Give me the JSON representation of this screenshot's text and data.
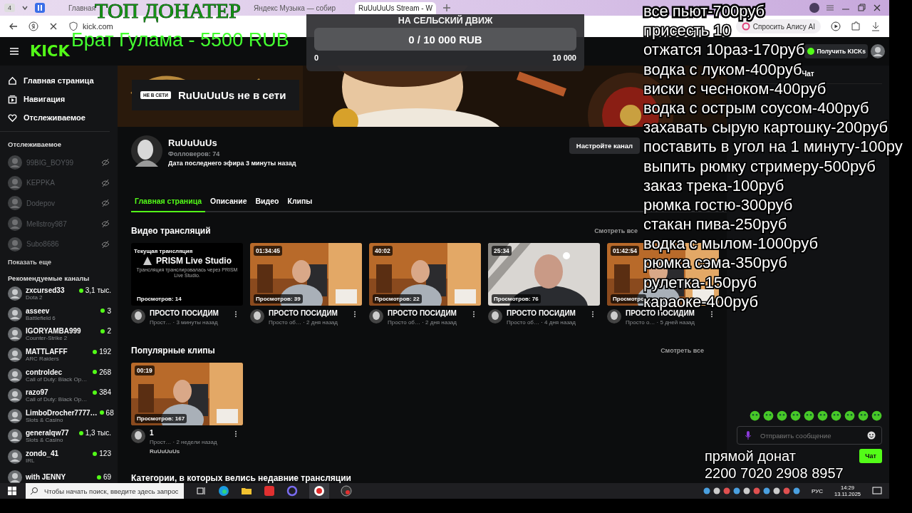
{
  "browser": {
    "tab_count": "4",
    "tabs": [
      {
        "title": "Главная",
        "selected": false
      },
      {
        "title": "Яндекс Музыка — собир",
        "selected": false
      },
      {
        "title": "RuUuUuUs Stream - W",
        "selected": true
      }
    ],
    "address": "kick.com",
    "alice_button": "Спросить Алису AI"
  },
  "kick": {
    "logo": "KICK",
    "kicks_button": "Получить KICKs",
    "nav": [
      {
        "label": "Главная страница"
      },
      {
        "label": "Навигация"
      },
      {
        "label": "Отслеживаемое"
      }
    ],
    "following_title": "Отслеживаемое",
    "following": [
      {
        "name": "99BIG_BOY99",
        "online": false
      },
      {
        "name": "KEPPKA",
        "online": false
      },
      {
        "name": "Dodepov",
        "online": false
      },
      {
        "name": "Mellstroy987",
        "online": false
      },
      {
        "name": "Subo8686",
        "online": false
      }
    ],
    "show_more": "Показать еще",
    "recommended_title": "Рекомендуемые каналы",
    "recommended": [
      {
        "name": "zxcursed33",
        "game": "Dota 2",
        "viewers": "3,1 тыс."
      },
      {
        "name": "asseev",
        "game": "Battlefield 6",
        "viewers": "3"
      },
      {
        "name": "IGORYAMBA999",
        "game": "Counter-Strike 2",
        "viewers": "2"
      },
      {
        "name": "MATTLAFFF",
        "game": "ARC Raiders",
        "viewers": "192"
      },
      {
        "name": "controldec",
        "game": "Call of Duty: Black Op…",
        "viewers": "268"
      },
      {
        "name": "razo97",
        "game": "Call of Duty: Black Op…",
        "viewers": "384"
      },
      {
        "name": "LimboDrocher7777…",
        "game": "Slots & Casino",
        "viewers": "68"
      },
      {
        "name": "generalqw77",
        "game": "Slots & Casino",
        "viewers": "1,3 тыс."
      },
      {
        "name": "zondo_41",
        "game": "IRL",
        "viewers": "123"
      },
      {
        "name": "with JENNY",
        "viewers": "69"
      }
    ],
    "offline_badge": "НЕ В СЕТИ",
    "offline_text": "RuUuUuUs не в сети",
    "channel": {
      "name": "RuUuUuUs",
      "followers": "Фолловеров: 74",
      "last_stream": "Дата последнего эфира 3 минуты назад",
      "customize_button": "Настройте канал"
    },
    "channel_tabs": [
      {
        "label": "Главная страница",
        "selected": true
      },
      {
        "label": "Описание",
        "selected": false
      },
      {
        "label": "Видео",
        "selected": false
      },
      {
        "label": "Клипы",
        "selected": false
      }
    ],
    "videos_title": "Видео трансляций",
    "videos": [
      {
        "kind": "placeholder",
        "label": "Текущая трансляция",
        "brand": "PRISM Live Studio",
        "note": "Трансляция транслировалась через PRISM Live Studio.",
        "views": "Просмотров: 14",
        "title": "ПРОСТО ПОСИДИМ",
        "meta": "Прост… · 3 минуты назад"
      },
      {
        "kind": "picture",
        "duration": "01:34:45",
        "views": "Просмотров: 39",
        "title": "ПРОСТО ПОСИДИМ",
        "meta": "Просто об… · 2 дня назад"
      },
      {
        "kind": "picture",
        "duration": "40:02",
        "views": "Просмотров: 22",
        "title": "ПРОСТО ПОСИДИМ",
        "meta": "Просто об… · 2 дня назад"
      },
      {
        "kind": "picture",
        "duration": "25:34",
        "views": "Просмотров: 76",
        "title": "ПРОСТО ПОСИДИМ",
        "meta": "Просто об… · 4 дня назад"
      },
      {
        "kind": "picture",
        "duration": "01:42:54",
        "views": "Просмотро",
        "title": "ПРОСТО ПОСИДИМ",
        "meta": "Просто о… · 5 дней назад"
      }
    ],
    "see_all": "Смотреть все",
    "clips_title": "Популярные клипы",
    "clips_see_all": "Смотреть все",
    "clips": [
      {
        "kind": "picture",
        "duration": "00:19",
        "views": "Просмотров: 167",
        "title": "1",
        "meta": "Прост… · 2 недели назад",
        "channel": "RuUuUuUs"
      }
    ],
    "categories_title": "Категории, в которых велись недавние трансляции",
    "chat": {
      "title": "Чат",
      "placeholder": "Отправить сообщение",
      "send_button": "Чат"
    }
  },
  "overlay": {
    "top_title": "ТОП ДОНАТЕР",
    "top_donor": "Брат Гулама - 5500 RUB",
    "goal": {
      "title": "НА СЕЛЬСКИЙ ДВИЖ",
      "progress": "0 / 10 000 RUB",
      "level": 0,
      "min": "0",
      "max": "10 000"
    },
    "prices": [
      "все пьют-700руб",
      "присесть 10",
      "отжатся 10раз-170руб",
      "водка с луком-400руб",
      "виски с чесноком-400руб",
      "водка с острым соусом-400руб",
      "захавать сырую картошку-200руб",
      "поставить в угол на 1 минуту-100ру",
      "выпить рюмку стримеру-500руб",
      "заказ трека-100руб",
      "рюмка гостю-300руб",
      "стакан пива-250руб",
      "водка с мылом-1000руб",
      "рюмка сэма-350руб",
      "рулетка-150руб",
      "караоке-400руб"
    ],
    "donate_title": "прямой донат",
    "donate_card": "2200 7020 2908 8957"
  },
  "taskbar": {
    "search_placeholder": "Чтобы начать поиск, введите здесь запрос",
    "language": "РУС",
    "time": "14:29",
    "date": "13.11.2025"
  }
}
